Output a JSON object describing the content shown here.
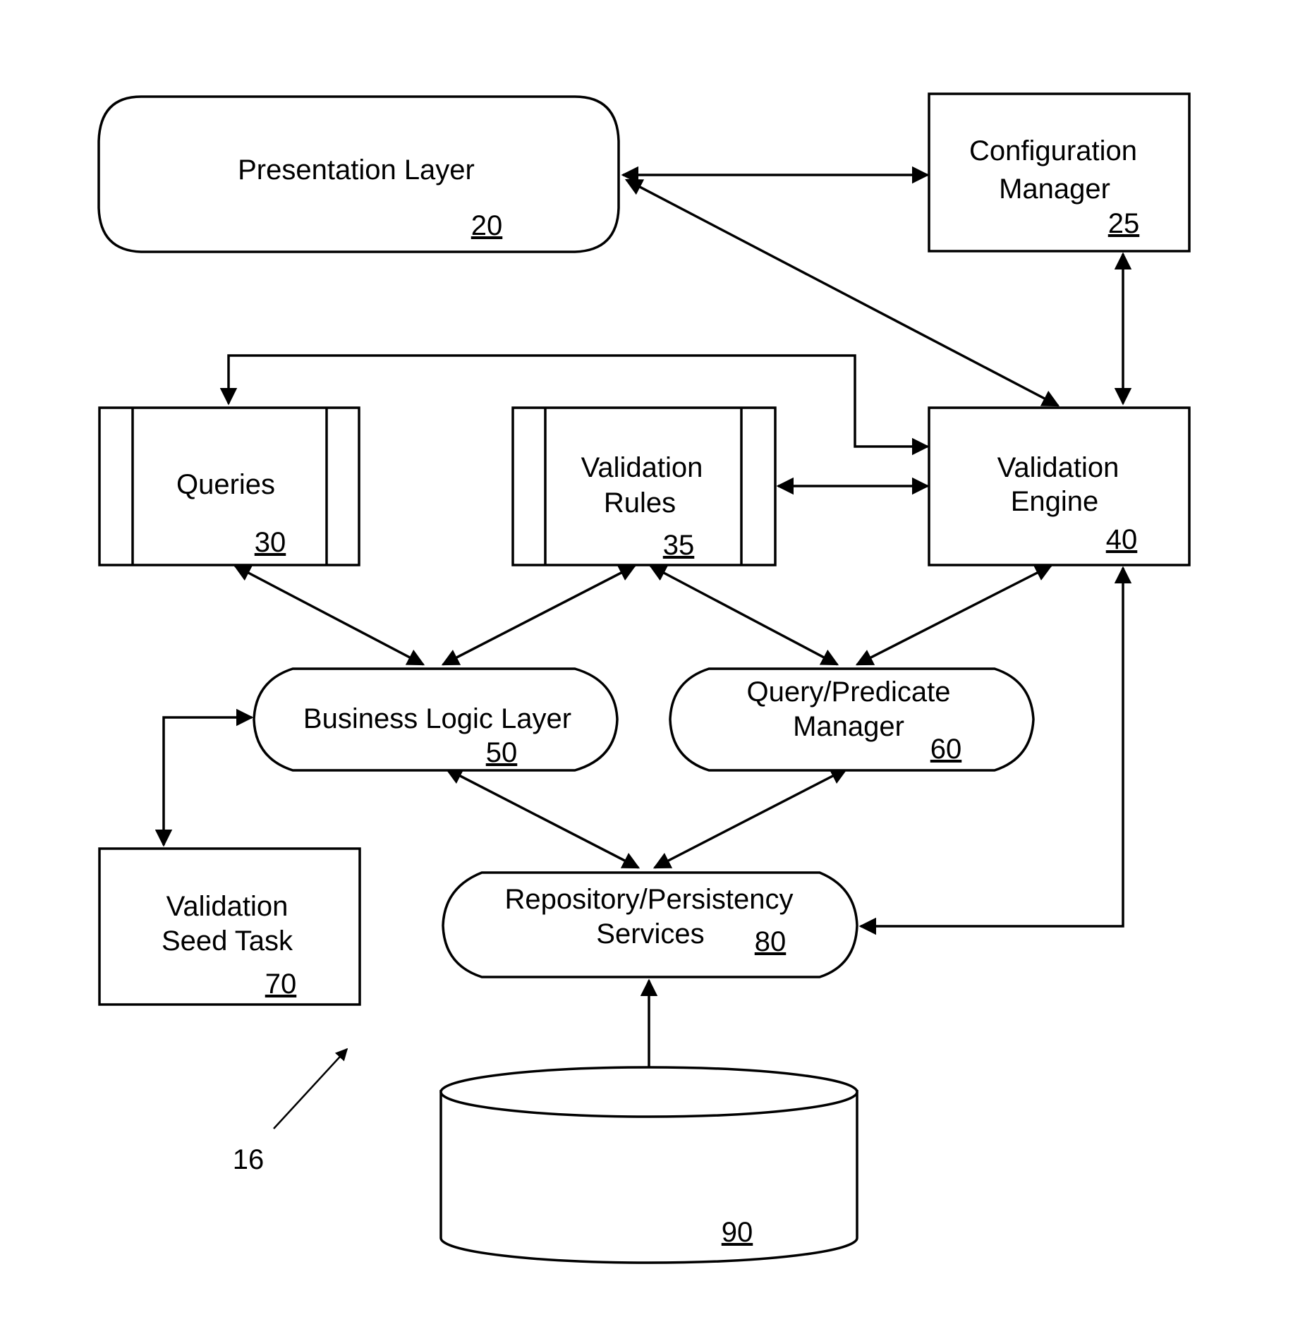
{
  "figure_label": "16",
  "components": {
    "presentation_layer": {
      "name": "Presentation Layer",
      "ref": "20"
    },
    "configuration_manager": {
      "line1": "Configuration",
      "line2": "Manager",
      "ref": "25"
    },
    "queries": {
      "name": "Queries",
      "ref": "30"
    },
    "validation_rules": {
      "line1": "Validation",
      "line2": "Rules",
      "ref": "35"
    },
    "validation_engine": {
      "line1": "Validation",
      "line2": "Engine",
      "ref": "40"
    },
    "business_logic_layer": {
      "name": "Business Logic Layer",
      "ref": "50"
    },
    "query_predicate_manager": {
      "line1": "Query/Predicate",
      "line2": "Manager",
      "ref": "60"
    },
    "validation_seed_task": {
      "line1": "Validation",
      "line2": "Seed Task",
      "ref": "70"
    },
    "repository_persistency_services": {
      "line1": "Repository/Persistency",
      "line2": "Services",
      "ref": "80"
    },
    "database": {
      "ref": "90"
    }
  },
  "connections": [
    {
      "from": "Presentation Layer",
      "to": "Configuration Manager",
      "direction": "bidirectional"
    },
    {
      "from": "Presentation Layer",
      "to": "Validation Engine",
      "direction": "bidirectional"
    },
    {
      "from": "Configuration Manager",
      "to": "Validation Engine",
      "direction": "bidirectional"
    },
    {
      "from": "Queries",
      "to": "Validation Engine",
      "direction": "bidirectional"
    },
    {
      "from": "Validation Rules",
      "to": "Validation Engine",
      "direction": "bidirectional"
    },
    {
      "from": "Queries",
      "to": "Business Logic Layer",
      "direction": "bidirectional"
    },
    {
      "from": "Validation Rules",
      "to": "Business Logic Layer",
      "direction": "bidirectional"
    },
    {
      "from": "Validation Rules",
      "to": "Query/Predicate Manager",
      "direction": "bidirectional"
    },
    {
      "from": "Validation Engine",
      "to": "Query/Predicate Manager",
      "direction": "bidirectional"
    },
    {
      "from": "Business Logic Layer",
      "to": "Validation Seed Task",
      "direction": "bidirectional"
    },
    {
      "from": "Business Logic Layer",
      "to": "Repository/Persistency Services",
      "direction": "bidirectional"
    },
    {
      "from": "Query/Predicate Manager",
      "to": "Repository/Persistency Services",
      "direction": "bidirectional"
    },
    {
      "from": "Validation Engine",
      "to": "Repository/Persistency Services",
      "direction": "bidirectional"
    },
    {
      "from": "Repository/Persistency Services",
      "to": "Database 90",
      "direction": "bidirectional"
    }
  ]
}
